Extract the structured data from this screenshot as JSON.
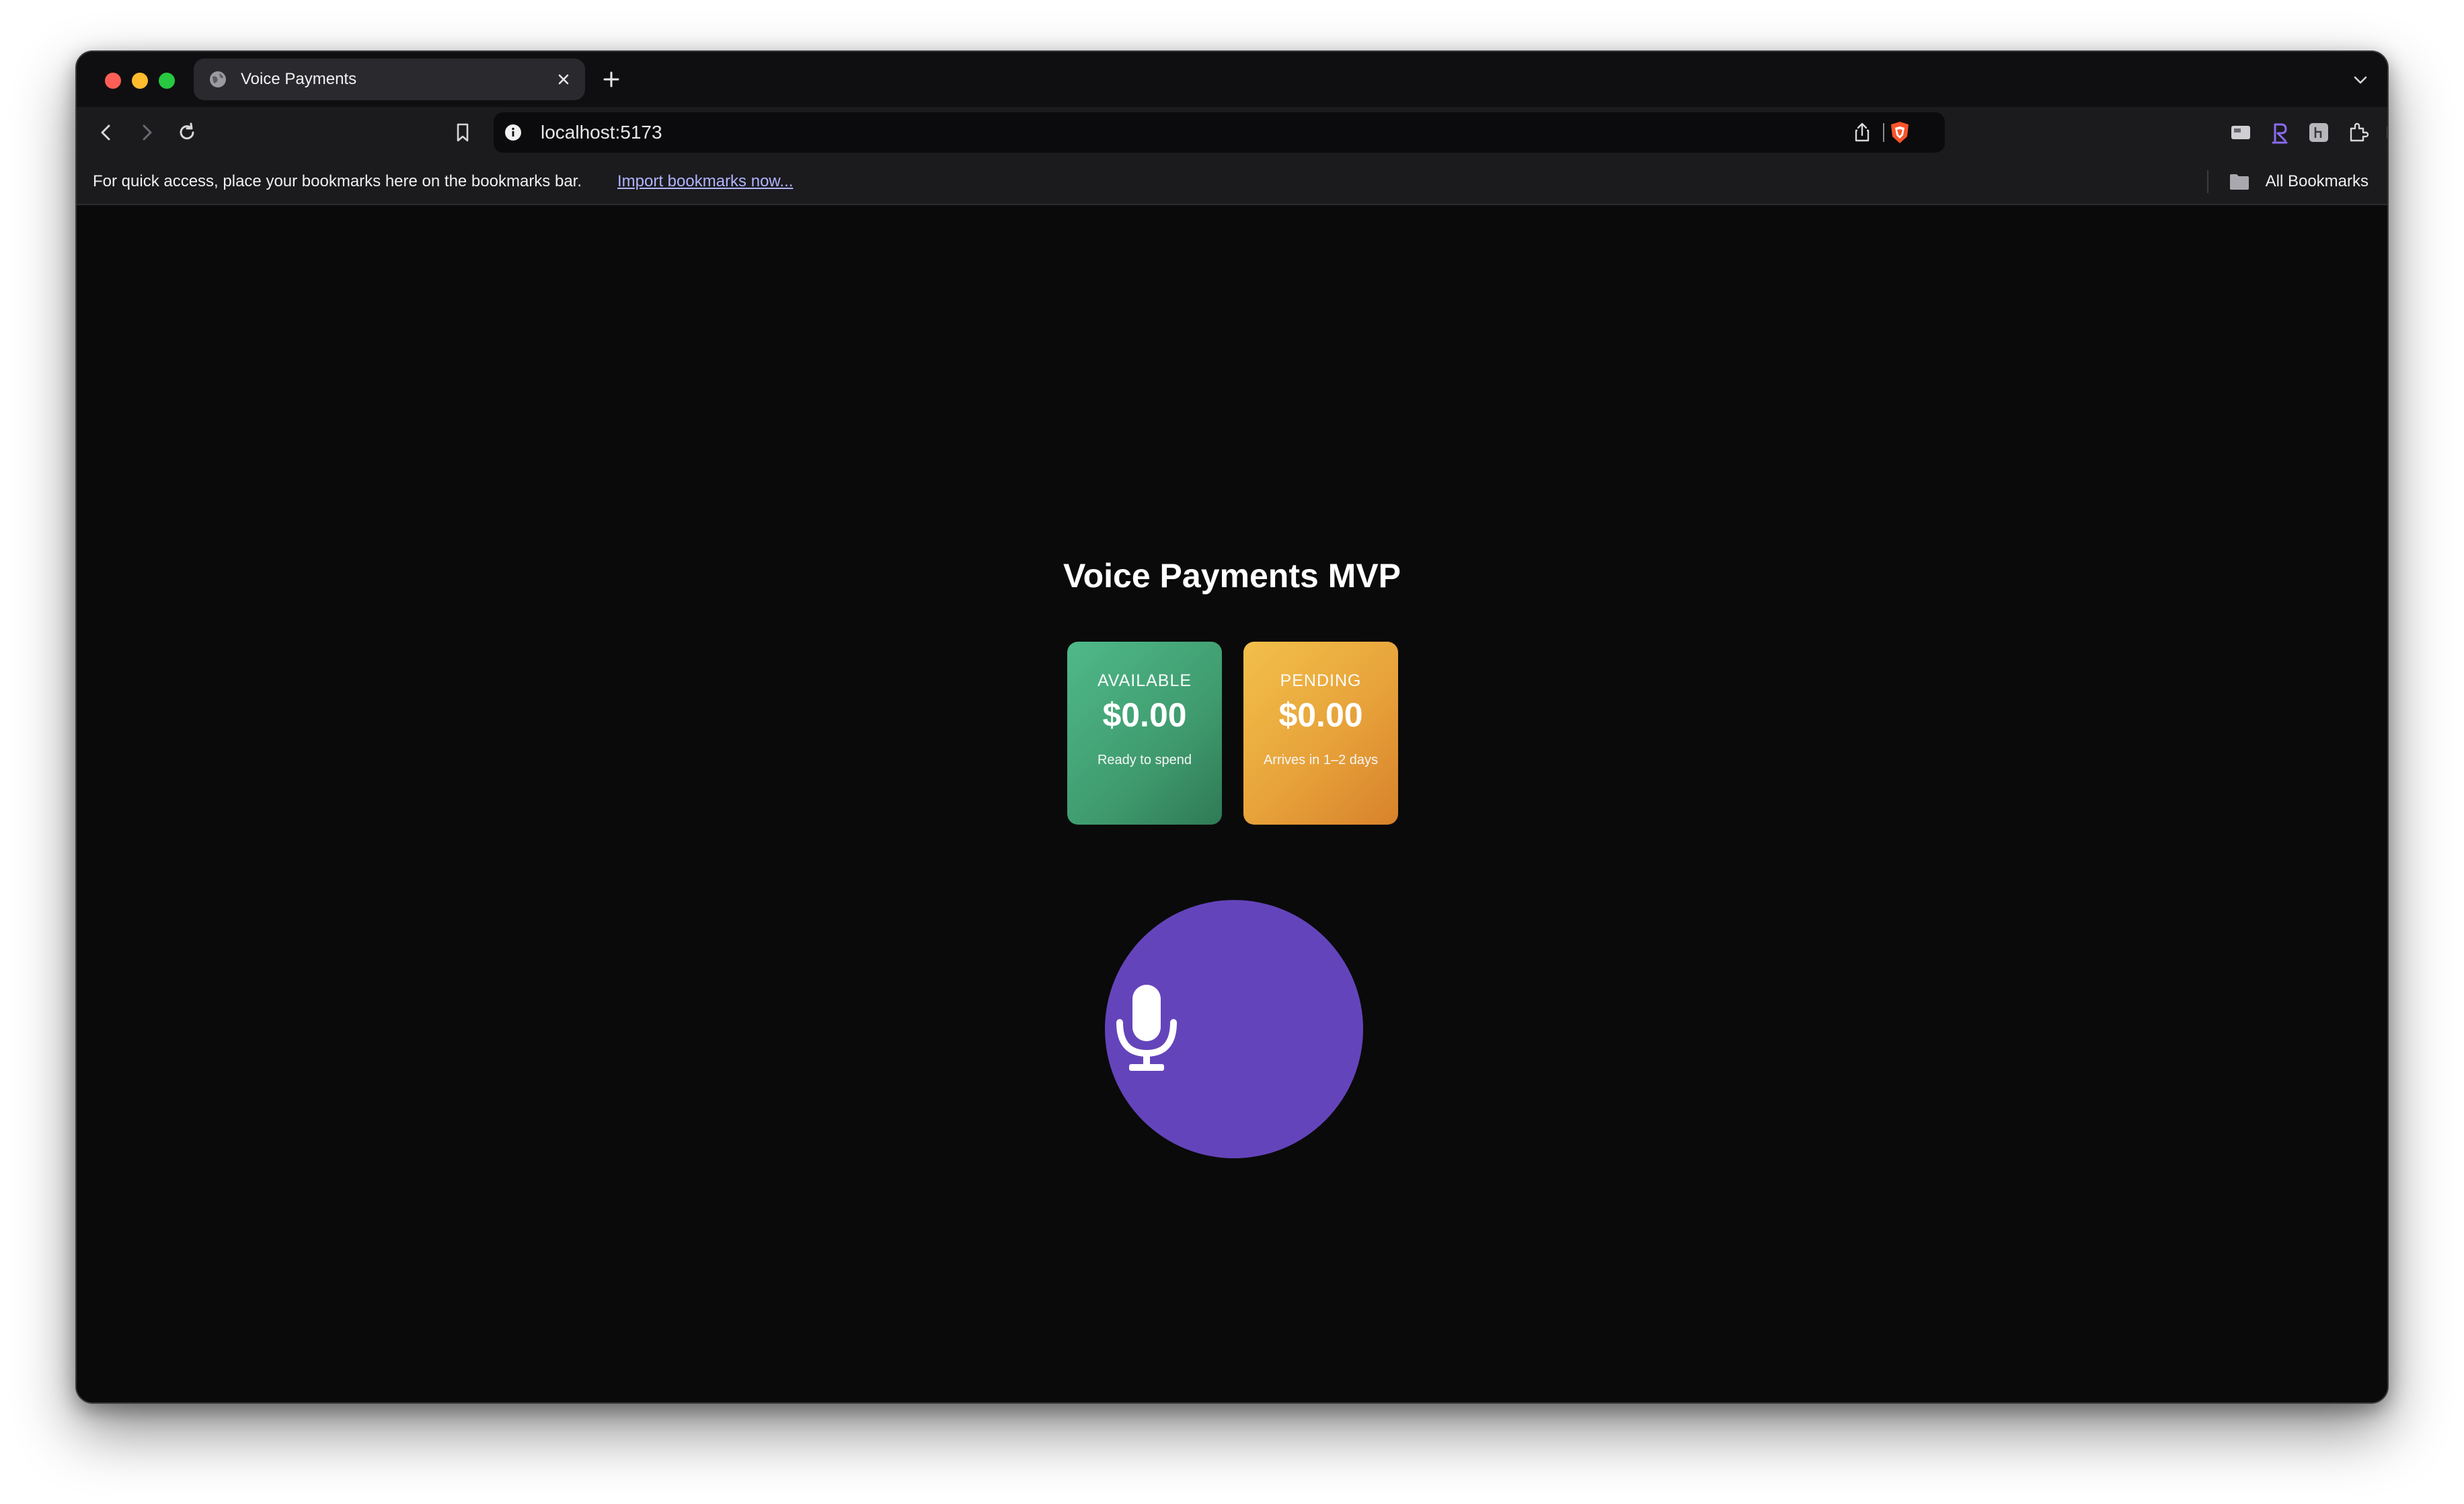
{
  "browser": {
    "tab": {
      "title": "Voice Payments"
    },
    "address_bar": {
      "url": "localhost:5173"
    },
    "bookmarks_bar": {
      "message": "For quick access, place your bookmarks here on the bookmarks bar.",
      "import_link": "Import bookmarks now...",
      "all_bookmarks": "All Bookmarks"
    }
  },
  "page": {
    "title": "Voice Payments MVP",
    "balances": [
      {
        "label": "AVAILABLE",
        "amount": "$0.00",
        "note": "Ready to spend"
      },
      {
        "label": "PENDING",
        "amount": "$0.00",
        "note": "Arrives in 1–2 days"
      }
    ],
    "mic_button": {
      "icon": "microphone-icon",
      "color": "#6444bb"
    }
  },
  "colors": {
    "background": "#0a0a0a",
    "available_card": "#3f9b6e",
    "pending_card": "#e7a23a",
    "accent": "#6444bb",
    "link": "#b0b4ff"
  }
}
